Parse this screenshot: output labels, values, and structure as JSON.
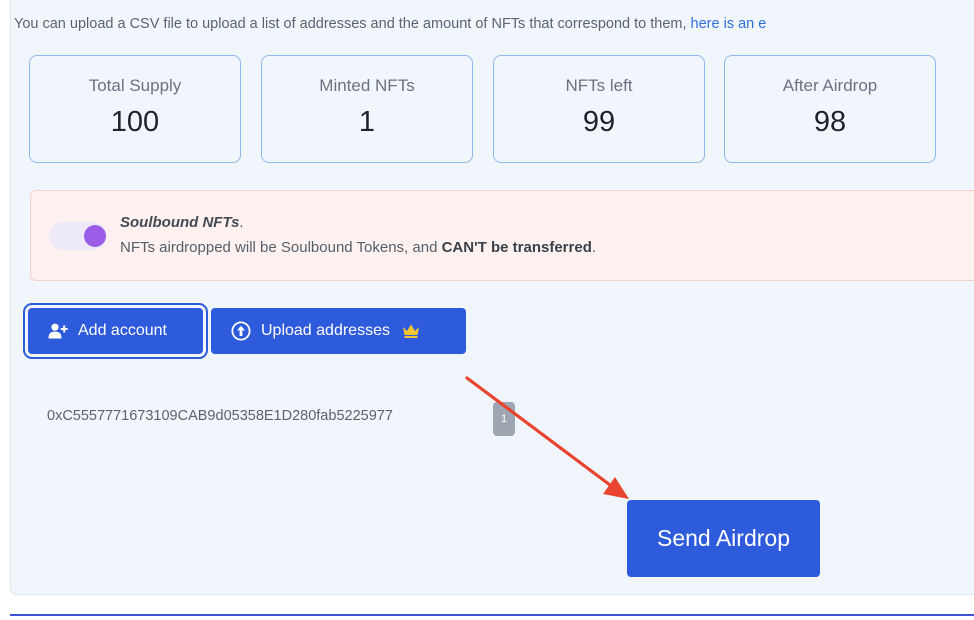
{
  "intro": {
    "text": "You can upload a CSV file to upload a list of addresses and the amount of NFTs that correspond to them, ",
    "link": "here is an e"
  },
  "stats": [
    {
      "label": "Total Supply",
      "value": "100"
    },
    {
      "label": "Minted NFTs",
      "value": "1"
    },
    {
      "label": "NFTs left",
      "value": "99"
    },
    {
      "label": "After Airdrop",
      "value": "98"
    }
  ],
  "soulbound": {
    "title": "Soulbound NFTs",
    "title_suffix": ".",
    "desc_prefix": "NFTs airdropped will be Soulbound Tokens, and ",
    "desc_bold": "CAN'T be transferred",
    "desc_suffix": ".",
    "toggle_on": true
  },
  "buttons": {
    "add_account": "Add account",
    "upload_addresses": "Upload addresses"
  },
  "address_list": [
    {
      "address": "0xC5557771673109CAB9d05358E1D280fab5225977",
      "count": "1"
    }
  ],
  "send_button": "Send Airdrop",
  "colors": {
    "primary": "#2e5bdb",
    "toggle_knob": "#9b5de5",
    "warning_bg": "#fdf2ef",
    "arrow": "#e8442e",
    "crown": "#f4c530"
  },
  "icons": {
    "add_account": "user-plus-icon",
    "upload": "arrow-up-circle-icon",
    "premium": "crown-icon"
  }
}
